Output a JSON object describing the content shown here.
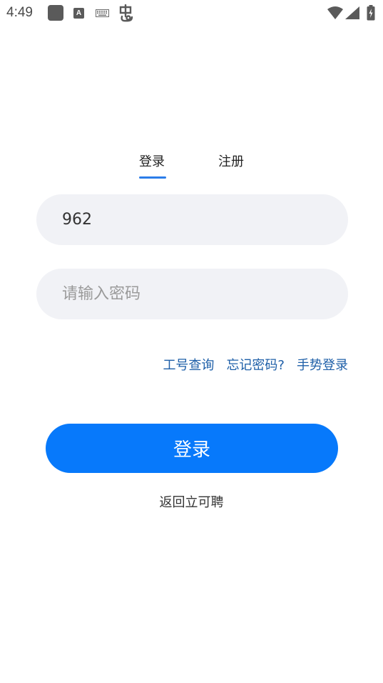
{
  "status_bar": {
    "time": "4:49",
    "icons": [
      "app-square-icon",
      "a-notification-icon",
      "keyboard-icon",
      "bug-icon",
      "wifi-icon",
      "signal-icon",
      "battery-icon"
    ]
  },
  "tabs": [
    {
      "label": "登录",
      "active": true
    },
    {
      "label": "注册",
      "active": false
    }
  ],
  "form": {
    "account_value": "962",
    "password_placeholder": "请输入密码",
    "password_value": ""
  },
  "links": {
    "employee_id_lookup": "工号查询",
    "forgot_password": "忘记密码?",
    "gesture_login": "手势登录"
  },
  "login_button_label": "登录",
  "back_link_label": "返回立可聘",
  "colors": {
    "accent": "#0779fb",
    "tab_underline": "#2b7de9",
    "link": "#1e5fa8",
    "input_bg": "#f1f2f6"
  }
}
